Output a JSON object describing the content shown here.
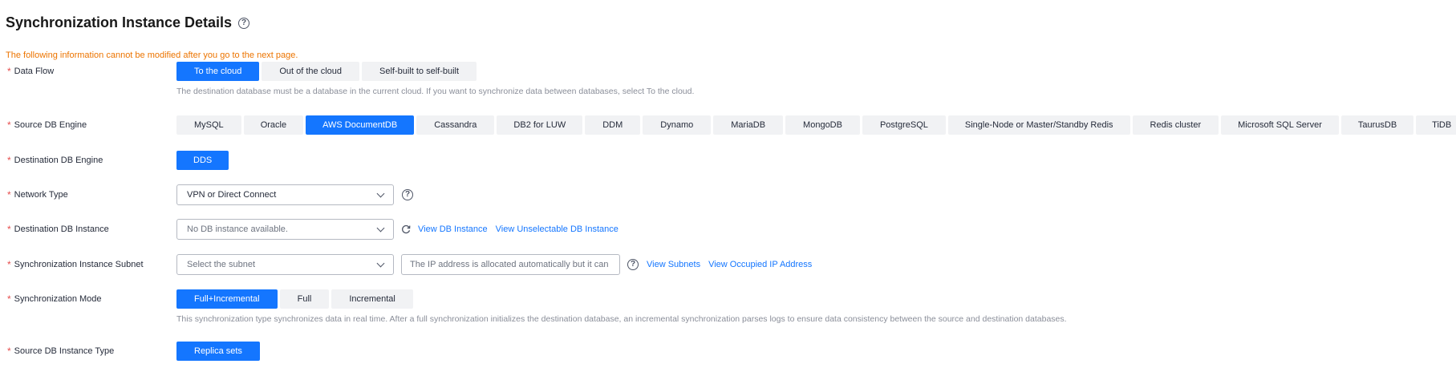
{
  "page_title": "Synchronization Instance Details",
  "notice": "The following information cannot be modified after you go to the next page.",
  "required_mark": "*",
  "help_glyph": "?",
  "data_flow": {
    "label": "Data Flow",
    "options": [
      "To the cloud",
      "Out of the cloud",
      "Self-built to self-built"
    ],
    "selected": "To the cloud",
    "hint": "The destination database must be a database in the current cloud. If you want to synchronize data between databases, select To the cloud."
  },
  "source_engine": {
    "label": "Source DB Engine",
    "options": [
      "MySQL",
      "Oracle",
      "AWS DocumentDB",
      "Cassandra",
      "DB2 for LUW",
      "DDM",
      "Dynamo",
      "MariaDB",
      "MongoDB",
      "PostgreSQL",
      "Single-Node or Master/Standby Redis",
      "Redis cluster",
      "Microsoft SQL Server",
      "TaurusDB",
      "TiDB"
    ],
    "selected": "AWS DocumentDB"
  },
  "dest_engine": {
    "label": "Destination DB Engine",
    "options": [
      "DDS"
    ],
    "selected": "DDS"
  },
  "network_type": {
    "label": "Network Type",
    "value": "VPN or Direct Connect"
  },
  "dest_instance": {
    "label": "Destination DB Instance",
    "placeholder": "No DB instance available.",
    "view_link": "View DB Instance",
    "unselectable_link": "View Unselectable DB Instance"
  },
  "subnet": {
    "label": "Synchronization Instance Subnet",
    "placeholder": "Select the subnet",
    "ip_placeholder": "The IP address is allocated automatically but it can",
    "view_subnets": "View Subnets",
    "view_occupied": "View Occupied IP Address"
  },
  "sync_mode": {
    "label": "Synchronization Mode",
    "options": [
      "Full+Incremental",
      "Full",
      "Incremental"
    ],
    "selected": "Full+Incremental",
    "hint": "This synchronization type synchronizes data in real time. After a full synchronization initializes the destination database, an incremental synchronization parses logs to ensure data consistency between the source and destination databases."
  },
  "source_instance_type": {
    "label": "Source DB Instance Type",
    "options": [
      "Replica sets"
    ],
    "selected": "Replica sets"
  },
  "colors": {
    "primary": "#1476ff",
    "notice": "#ec7400",
    "required": "#e64d4d",
    "segment_bg": "#f1f2f4",
    "hint": "#8a8e99"
  }
}
